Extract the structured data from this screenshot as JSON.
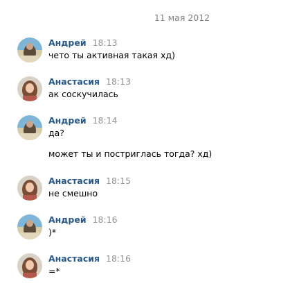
{
  "date_divider": "11 мая 2012",
  "colors": {
    "author": "#2a5885",
    "time": "#939393",
    "date": "#828282"
  },
  "messages": [
    {
      "author": "Андрей",
      "avatar_icon": "andrey-avatar-icon",
      "time": "18:13",
      "lines": [
        "чето ты активная такая хд)"
      ]
    },
    {
      "author": "Анастасия",
      "avatar_icon": "anastasia-avatar-icon",
      "time": "18:13",
      "lines": [
        "ак соскучилась"
      ]
    },
    {
      "author": "Андрей",
      "avatar_icon": "andrey-avatar-icon",
      "time": "18:14",
      "lines": [
        "да?",
        "может ты и постриглась тогда? хд)"
      ]
    },
    {
      "author": "Анастасия",
      "avatar_icon": "anastasia-avatar-icon",
      "time": "18:15",
      "lines": [
        "не смешно"
      ]
    },
    {
      "author": "Андрей",
      "avatar_icon": "andrey-avatar-icon",
      "time": "18:16",
      "lines": [
        ")*"
      ]
    },
    {
      "author": "Анастасия",
      "avatar_icon": "anastasia-avatar-icon",
      "time": "18:16",
      "lines": [
        "=*"
      ]
    }
  ]
}
